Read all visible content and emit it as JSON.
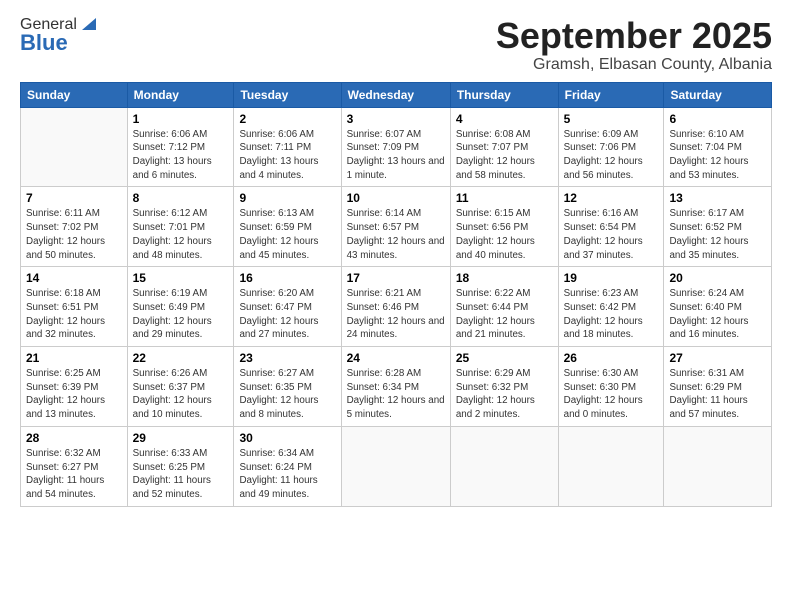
{
  "logo": {
    "general": "General",
    "blue": "Blue"
  },
  "header": {
    "month": "September 2025",
    "location": "Gramsh, Elbasan County, Albania"
  },
  "weekdays": [
    "Sunday",
    "Monday",
    "Tuesday",
    "Wednesday",
    "Thursday",
    "Friday",
    "Saturday"
  ],
  "weeks": [
    [
      {
        "day": "",
        "empty": true
      },
      {
        "day": "1",
        "sunrise": "6:06 AM",
        "sunset": "7:12 PM",
        "daylight": "13 hours and 6 minutes."
      },
      {
        "day": "2",
        "sunrise": "6:06 AM",
        "sunset": "7:11 PM",
        "daylight": "13 hours and 4 minutes."
      },
      {
        "day": "3",
        "sunrise": "6:07 AM",
        "sunset": "7:09 PM",
        "daylight": "13 hours and 1 minute."
      },
      {
        "day": "4",
        "sunrise": "6:08 AM",
        "sunset": "7:07 PM",
        "daylight": "12 hours and 58 minutes."
      },
      {
        "day": "5",
        "sunrise": "6:09 AM",
        "sunset": "7:06 PM",
        "daylight": "12 hours and 56 minutes."
      },
      {
        "day": "6",
        "sunrise": "6:10 AM",
        "sunset": "7:04 PM",
        "daylight": "12 hours and 53 minutes."
      }
    ],
    [
      {
        "day": "7",
        "sunrise": "6:11 AM",
        "sunset": "7:02 PM",
        "daylight": "12 hours and 50 minutes."
      },
      {
        "day": "8",
        "sunrise": "6:12 AM",
        "sunset": "7:01 PM",
        "daylight": "12 hours and 48 minutes."
      },
      {
        "day": "9",
        "sunrise": "6:13 AM",
        "sunset": "6:59 PM",
        "daylight": "12 hours and 45 minutes."
      },
      {
        "day": "10",
        "sunrise": "6:14 AM",
        "sunset": "6:57 PM",
        "daylight": "12 hours and 43 minutes."
      },
      {
        "day": "11",
        "sunrise": "6:15 AM",
        "sunset": "6:56 PM",
        "daylight": "12 hours and 40 minutes."
      },
      {
        "day": "12",
        "sunrise": "6:16 AM",
        "sunset": "6:54 PM",
        "daylight": "12 hours and 37 minutes."
      },
      {
        "day": "13",
        "sunrise": "6:17 AM",
        "sunset": "6:52 PM",
        "daylight": "12 hours and 35 minutes."
      }
    ],
    [
      {
        "day": "14",
        "sunrise": "6:18 AM",
        "sunset": "6:51 PM",
        "daylight": "12 hours and 32 minutes."
      },
      {
        "day": "15",
        "sunrise": "6:19 AM",
        "sunset": "6:49 PM",
        "daylight": "12 hours and 29 minutes."
      },
      {
        "day": "16",
        "sunrise": "6:20 AM",
        "sunset": "6:47 PM",
        "daylight": "12 hours and 27 minutes."
      },
      {
        "day": "17",
        "sunrise": "6:21 AM",
        "sunset": "6:46 PM",
        "daylight": "12 hours and 24 minutes."
      },
      {
        "day": "18",
        "sunrise": "6:22 AM",
        "sunset": "6:44 PM",
        "daylight": "12 hours and 21 minutes."
      },
      {
        "day": "19",
        "sunrise": "6:23 AM",
        "sunset": "6:42 PM",
        "daylight": "12 hours and 18 minutes."
      },
      {
        "day": "20",
        "sunrise": "6:24 AM",
        "sunset": "6:40 PM",
        "daylight": "12 hours and 16 minutes."
      }
    ],
    [
      {
        "day": "21",
        "sunrise": "6:25 AM",
        "sunset": "6:39 PM",
        "daylight": "12 hours and 13 minutes."
      },
      {
        "day": "22",
        "sunrise": "6:26 AM",
        "sunset": "6:37 PM",
        "daylight": "12 hours and 10 minutes."
      },
      {
        "day": "23",
        "sunrise": "6:27 AM",
        "sunset": "6:35 PM",
        "daylight": "12 hours and 8 minutes."
      },
      {
        "day": "24",
        "sunrise": "6:28 AM",
        "sunset": "6:34 PM",
        "daylight": "12 hours and 5 minutes."
      },
      {
        "day": "25",
        "sunrise": "6:29 AM",
        "sunset": "6:32 PM",
        "daylight": "12 hours and 2 minutes."
      },
      {
        "day": "26",
        "sunrise": "6:30 AM",
        "sunset": "6:30 PM",
        "daylight": "12 hours and 0 minutes."
      },
      {
        "day": "27",
        "sunrise": "6:31 AM",
        "sunset": "6:29 PM",
        "daylight": "11 hours and 57 minutes."
      }
    ],
    [
      {
        "day": "28",
        "sunrise": "6:32 AM",
        "sunset": "6:27 PM",
        "daylight": "11 hours and 54 minutes."
      },
      {
        "day": "29",
        "sunrise": "6:33 AM",
        "sunset": "6:25 PM",
        "daylight": "11 hours and 52 minutes."
      },
      {
        "day": "30",
        "sunrise": "6:34 AM",
        "sunset": "6:24 PM",
        "daylight": "11 hours and 49 minutes."
      },
      {
        "day": "",
        "empty": true
      },
      {
        "day": "",
        "empty": true
      },
      {
        "day": "",
        "empty": true
      },
      {
        "day": "",
        "empty": true
      }
    ]
  ],
  "labels": {
    "sunrise": "Sunrise:",
    "sunset": "Sunset:",
    "daylight": "Daylight:"
  }
}
